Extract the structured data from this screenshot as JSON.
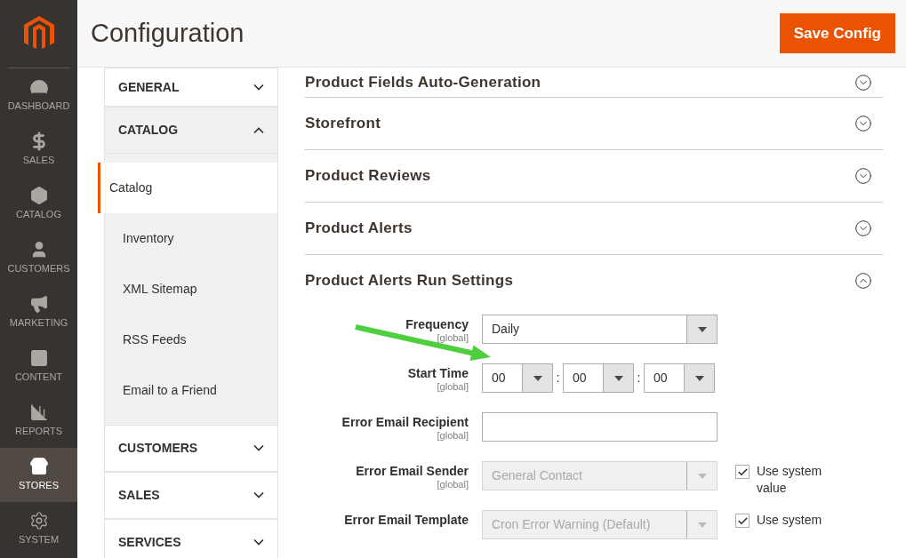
{
  "nav": [
    {
      "kind": "dashboard",
      "label": "DASHBOARD",
      "selected": false
    },
    {
      "kind": "sales",
      "label": "SALES",
      "selected": false
    },
    {
      "kind": "catalog",
      "label": "CATALOG",
      "selected": false
    },
    {
      "kind": "customers",
      "label": "CUSTOMERS",
      "selected": false
    },
    {
      "kind": "marketing",
      "label": "MARKETING",
      "selected": false
    },
    {
      "kind": "content",
      "label": "CONTENT",
      "selected": false
    },
    {
      "kind": "reports",
      "label": "REPORTS",
      "selected": false
    },
    {
      "kind": "stores",
      "label": "STORES",
      "selected": true
    },
    {
      "kind": "system",
      "label": "SYSTEM",
      "selected": false
    }
  ],
  "page_title": "Configuration",
  "save_button": "Save Config",
  "config_tabs": [
    {
      "label": "GENERAL",
      "expanded": false
    },
    {
      "label": "CATALOG",
      "expanded": true,
      "children": [
        {
          "label": "Catalog",
          "selected": true
        },
        {
          "label": "Inventory",
          "selected": false
        },
        {
          "label": "XML Sitemap",
          "selected": false
        },
        {
          "label": "RSS Feeds",
          "selected": false
        },
        {
          "label": "Email to a Friend",
          "selected": false
        }
      ]
    },
    {
      "label": "CUSTOMERS",
      "expanded": false
    },
    {
      "label": "SALES",
      "expanded": false
    },
    {
      "label": "SERVICES",
      "expanded": false
    }
  ],
  "sections": [
    {
      "title": "Product Fields Auto-Generation",
      "expanded": false
    },
    {
      "title": "Storefront",
      "expanded": false
    },
    {
      "title": "Product Reviews",
      "expanded": false
    },
    {
      "title": "Product Alerts",
      "expanded": false
    },
    {
      "title": "Product Alerts Run Settings",
      "expanded": true
    }
  ],
  "fields": [
    {
      "kind": "select",
      "label": "Frequency",
      "scope": "[global]",
      "value": "Daily",
      "disabled": false
    },
    {
      "kind": "time",
      "label": "Start Time",
      "scope": "[global]",
      "parts": [
        "00",
        "00",
        "00"
      ],
      "separators": [
        ":",
        ":"
      ]
    },
    {
      "kind": "text",
      "label": "Error Email Recipient",
      "scope": "[global]"
    },
    {
      "kind": "select",
      "label": "Error Email Sender",
      "scope": "[global]",
      "value": "General Contact",
      "disabled": true,
      "system_value": {
        "label": "Use system value",
        "checked": true
      }
    },
    {
      "kind": "select",
      "label": "Error Email Template",
      "value": "Cron Error Warning (Default)",
      "disabled": true,
      "system_value": {
        "label": "Use system",
        "checked": true
      }
    }
  ]
}
